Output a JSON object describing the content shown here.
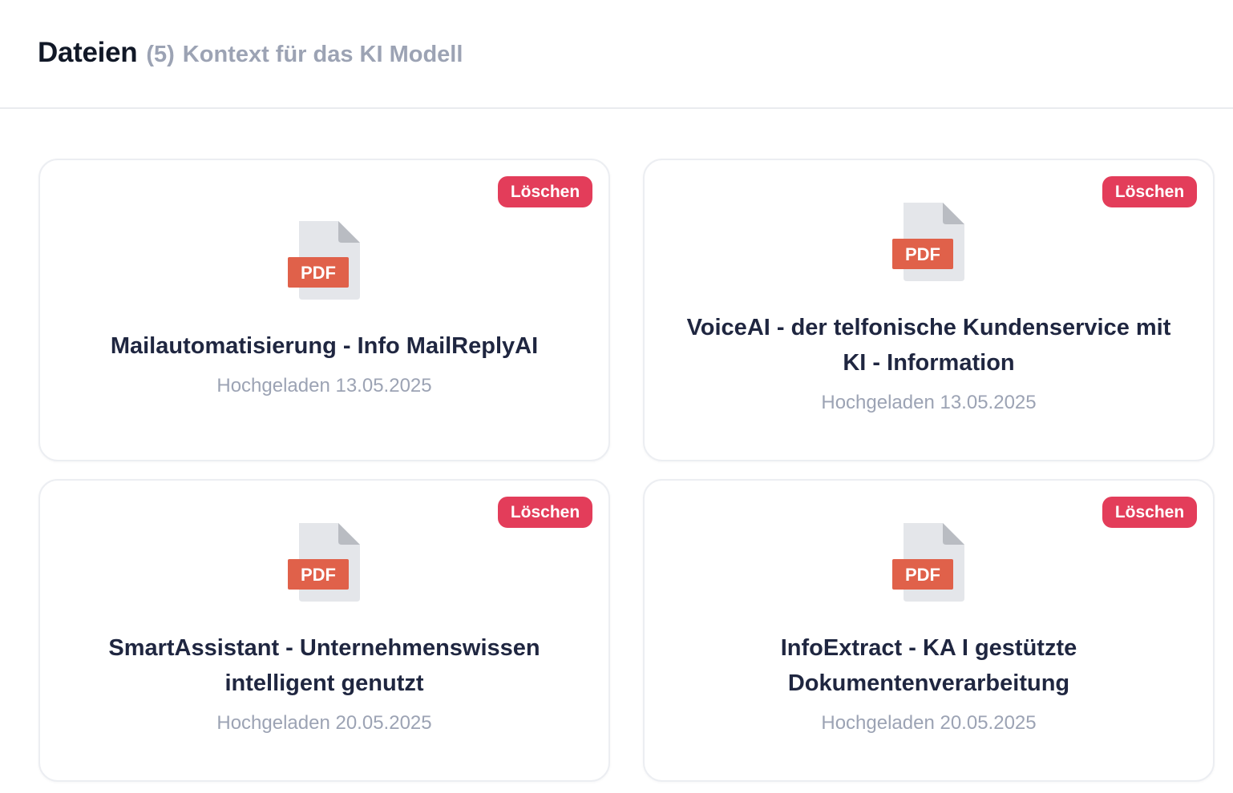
{
  "header": {
    "title": "Dateien",
    "count": "(5)",
    "subtitle": "Kontext für das KI Modell"
  },
  "files": [
    {
      "name": "Mailautomatisierung - Info MailReplyAI",
      "uploaded": "Hochgeladen 13.05.2025",
      "delete_label": "Löschen",
      "icon": "pdf-file-icon",
      "badge": "PDF"
    },
    {
      "name": "VoiceAI - der telfonische Kundenservice mit KI - Information",
      "uploaded": "Hochgeladen 13.05.2025",
      "delete_label": "Löschen",
      "icon": "pdf-file-icon",
      "badge": "PDF"
    },
    {
      "name": "SmartAssistant - Unternehmenswissen intelligent genutzt",
      "uploaded": "Hochgeladen 20.05.2025",
      "delete_label": "Löschen",
      "icon": "pdf-file-icon",
      "badge": "PDF"
    },
    {
      "name": "InfoExtract - KA I gestützte Dokumentenverarbeitung",
      "uploaded": "Hochgeladen 20.05.2025",
      "delete_label": "Löschen",
      "icon": "pdf-file-icon",
      "badge": "PDF"
    }
  ],
  "colors": {
    "delete_button": "#e33d5a",
    "pdf_badge": "#e0614a",
    "file_page": "#e4e6ea",
    "file_fold": "#b9bcc2",
    "title": "#111827",
    "muted": "#9ca3b4"
  }
}
